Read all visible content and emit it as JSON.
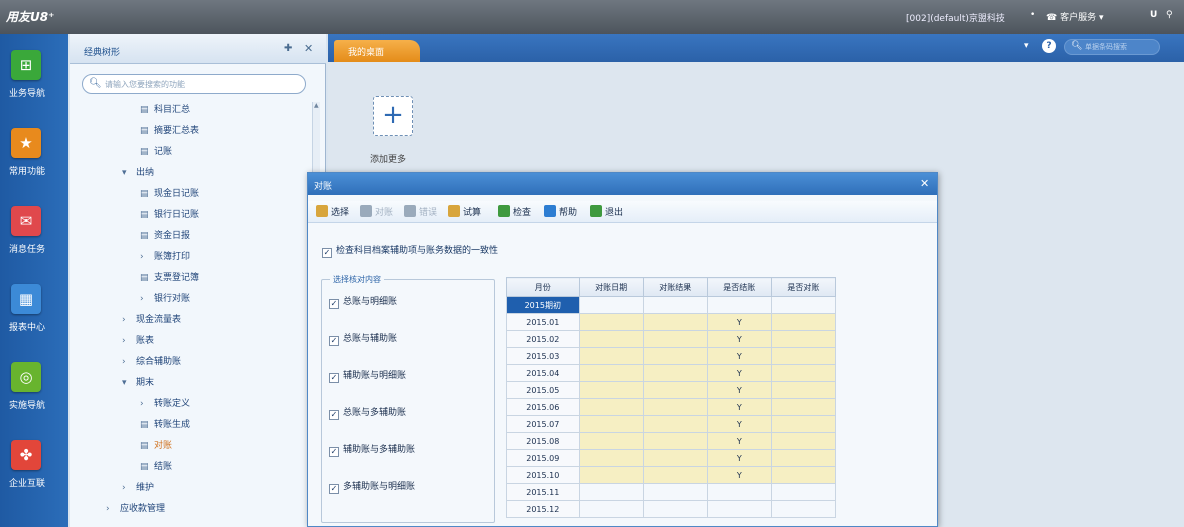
{
  "topbar": {
    "logo": "用友U8⁺",
    "account": "[002](default)京盟科技",
    "service_label": "客户服务",
    "user_label": "U"
  },
  "leftnav": [
    {
      "label": "业务导航",
      "icon": "business-nav-icon",
      "glyph": "⊞",
      "color": "#3aa83a"
    },
    {
      "label": "常用功能",
      "icon": "star-icon",
      "glyph": "★",
      "color": "#e88a1d"
    },
    {
      "label": "消息任务",
      "icon": "message-task-icon",
      "glyph": "✉",
      "color": "#e0484c"
    },
    {
      "label": "报表中心",
      "icon": "report-center-icon",
      "glyph": "▦",
      "color": "#3c8ad7"
    },
    {
      "label": "实施导航",
      "icon": "implementation-nav-icon",
      "glyph": "◎",
      "color": "#68b42e"
    },
    {
      "label": "企业互联",
      "icon": "enterprise-connect-icon",
      "glyph": "✤",
      "color": "#e2463a"
    }
  ],
  "tree": {
    "title": "经典树形",
    "search_placeholder": "请输入您要搜索的功能",
    "items": [
      {
        "label": "科目汇总",
        "kind": "doc",
        "indent": 70,
        "active": false
      },
      {
        "label": "摘要汇总表",
        "kind": "doc",
        "indent": 70,
        "active": false
      },
      {
        "label": "记账",
        "kind": "doc",
        "indent": 70,
        "active": false
      },
      {
        "label": "出纳",
        "kind": "open",
        "indent": 52,
        "active": false
      },
      {
        "label": "现金日记账",
        "kind": "doc",
        "indent": 70,
        "active": false
      },
      {
        "label": "银行日记账",
        "kind": "doc",
        "indent": 70,
        "active": false
      },
      {
        "label": "资金日报",
        "kind": "doc",
        "indent": 70,
        "active": false
      },
      {
        "label": "账簿打印",
        "kind": "closed",
        "indent": 70,
        "active": false
      },
      {
        "label": "支票登记簿",
        "kind": "doc",
        "indent": 70,
        "active": false
      },
      {
        "label": "银行对账",
        "kind": "closed",
        "indent": 70,
        "active": false
      },
      {
        "label": "现金流量表",
        "kind": "closed",
        "indent": 52,
        "active": false
      },
      {
        "label": "账表",
        "kind": "closed",
        "indent": 52,
        "active": false
      },
      {
        "label": "综合辅助账",
        "kind": "closed",
        "indent": 52,
        "active": false
      },
      {
        "label": "期末",
        "kind": "open",
        "indent": 52,
        "active": false
      },
      {
        "label": "转账定义",
        "kind": "closed",
        "indent": 70,
        "active": false
      },
      {
        "label": "转账生成",
        "kind": "doc",
        "indent": 70,
        "active": false
      },
      {
        "label": "对账",
        "kind": "doc",
        "indent": 70,
        "active": true
      },
      {
        "label": "结账",
        "kind": "doc",
        "indent": 70,
        "active": false
      },
      {
        "label": "维护",
        "kind": "closed",
        "indent": 52,
        "active": false
      },
      {
        "label": "应收款管理",
        "kind": "closed",
        "indent": 36,
        "active": false
      }
    ]
  },
  "main": {
    "tab_label": "我的桌面",
    "global_search_placeholder": "单据条码搜索",
    "add_more_label": "添加更多"
  },
  "dialog": {
    "title": "对账",
    "toolbar": [
      {
        "label": "选择",
        "icon": "select-icon",
        "color": "#d8a53c",
        "enabled": true
      },
      {
        "label": "对账",
        "icon": "reconcile-icon",
        "color": "#9aaabb",
        "enabled": false
      },
      {
        "label": "错误",
        "icon": "error-icon",
        "color": "#9aaabb",
        "enabled": false
      },
      {
        "label": "试算",
        "icon": "trial-balance-icon",
        "color": "#d8a53c",
        "enabled": true
      },
      {
        "label": "检查",
        "icon": "check-icon",
        "color": "#3f9a3f",
        "enabled": true
      },
      {
        "label": "帮助",
        "icon": "help-icon",
        "color": "#2d7dd2",
        "enabled": true
      },
      {
        "label": "退出",
        "icon": "exit-icon",
        "color": "#3f9a3f",
        "enabled": true
      }
    ],
    "check_consistency": "检查科目档案辅助项与账务数据的一致性",
    "group_title": "选择核对内容",
    "options": [
      "总账与明细账",
      "总账与辅助账",
      "辅助账与明细账",
      "总账与多辅助账",
      "辅助账与多辅助账",
      "多辅助账与明细账"
    ],
    "table": {
      "headers": [
        "月份",
        "对账日期",
        "对账结果",
        "是否结账",
        "是否对账"
      ],
      "rows": [
        {
          "month": "2015期初",
          "date": "",
          "result": "",
          "closed": "",
          "reconciled": "",
          "selected": true,
          "highlight": false
        },
        {
          "month": "2015.01",
          "date": "",
          "result": "",
          "closed": "Y",
          "reconciled": "",
          "selected": false,
          "highlight": true
        },
        {
          "month": "2015.02",
          "date": "",
          "result": "",
          "closed": "Y",
          "reconciled": "",
          "selected": false,
          "highlight": true
        },
        {
          "month": "2015.03",
          "date": "",
          "result": "",
          "closed": "Y",
          "reconciled": "",
          "selected": false,
          "highlight": true
        },
        {
          "month": "2015.04",
          "date": "",
          "result": "",
          "closed": "Y",
          "reconciled": "",
          "selected": false,
          "highlight": true
        },
        {
          "month": "2015.05",
          "date": "",
          "result": "",
          "closed": "Y",
          "reconciled": "",
          "selected": false,
          "highlight": true
        },
        {
          "month": "2015.06",
          "date": "",
          "result": "",
          "closed": "Y",
          "reconciled": "",
          "selected": false,
          "highlight": true
        },
        {
          "month": "2015.07",
          "date": "",
          "result": "",
          "closed": "Y",
          "reconciled": "",
          "selected": false,
          "highlight": true
        },
        {
          "month": "2015.08",
          "date": "",
          "result": "",
          "closed": "Y",
          "reconciled": "",
          "selected": false,
          "highlight": true
        },
        {
          "month": "2015.09",
          "date": "",
          "result": "",
          "closed": "Y",
          "reconciled": "",
          "selected": false,
          "highlight": true
        },
        {
          "month": "2015.10",
          "date": "",
          "result": "",
          "closed": "Y",
          "reconciled": "",
          "selected": false,
          "highlight": true
        },
        {
          "month": "2015.11",
          "date": "",
          "result": "",
          "closed": "",
          "reconciled": "",
          "selected": false,
          "highlight": false
        },
        {
          "month": "2015.12",
          "date": "",
          "result": "",
          "closed": "",
          "reconciled": "",
          "selected": false,
          "highlight": false
        }
      ]
    }
  }
}
